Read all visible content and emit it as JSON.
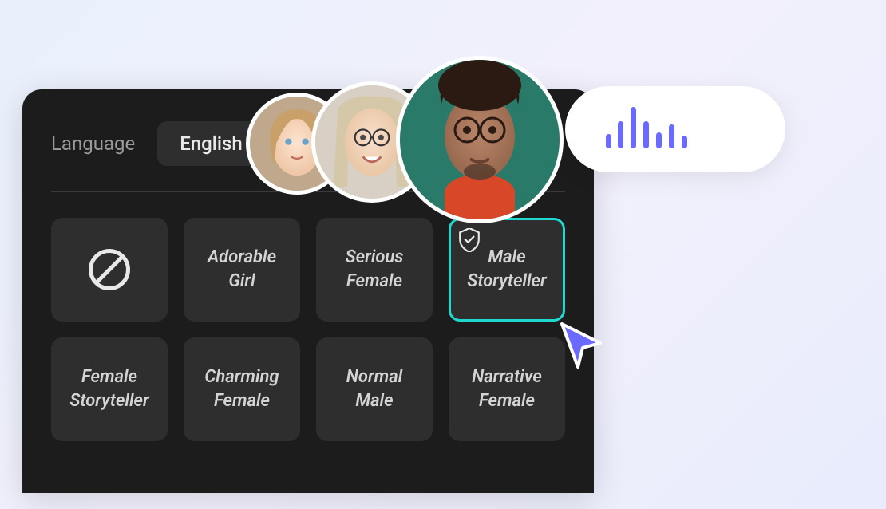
{
  "language": {
    "label": "Language",
    "value": "English"
  },
  "voices": [
    {
      "label": "",
      "type": "none",
      "selected": false
    },
    {
      "label": "Adorable Girl",
      "type": "voice",
      "selected": false
    },
    {
      "label": "Serious Female",
      "type": "voice",
      "selected": false
    },
    {
      "label": "Male Storyteller",
      "type": "voice",
      "selected": true,
      "badge": true
    },
    {
      "label": "Female Storyteller",
      "type": "voice",
      "selected": false
    },
    {
      "label": "Charming Female",
      "type": "voice",
      "selected": false
    },
    {
      "label": "Normal Male",
      "type": "voice",
      "selected": false
    },
    {
      "label": "Narrative Female",
      "type": "voice",
      "selected": false
    }
  ],
  "colors": {
    "accent": "#1fd8d0",
    "wave": "#6a6aff",
    "cursor": "#6a6aff"
  }
}
